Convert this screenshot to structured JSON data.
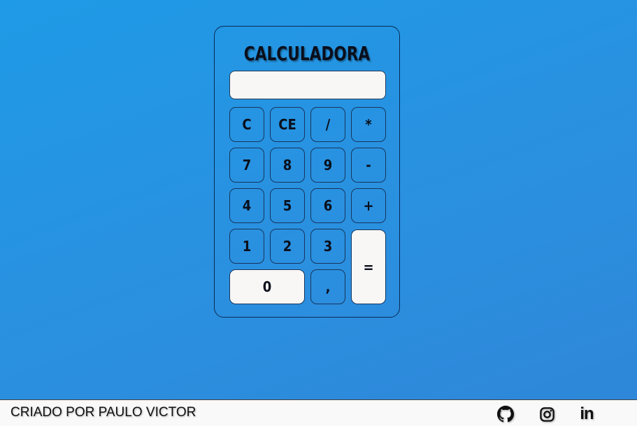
{
  "calculator": {
    "title": "CALCULADORA",
    "display_value": "",
    "keys": {
      "clear": "C",
      "clear_entry": "CE",
      "divide": "/",
      "multiply": "*",
      "seven": "7",
      "eight": "8",
      "nine": "9",
      "minus": "-",
      "four": "4",
      "five": "5",
      "six": "6",
      "plus": "+",
      "one": "1",
      "two": "2",
      "three": "3",
      "equals": "=",
      "zero": "0",
      "comma": ","
    }
  },
  "footer": {
    "credit": "CRIADO POR PAULO VICTOR",
    "social": {
      "github": "github-icon",
      "instagram": "instagram-icon",
      "linkedin_label": "in"
    }
  },
  "colors": {
    "background": "#2b8fdf",
    "light_key": "#f8f7f5",
    "border": "#17355e",
    "footer": "#f9f9f9"
  }
}
